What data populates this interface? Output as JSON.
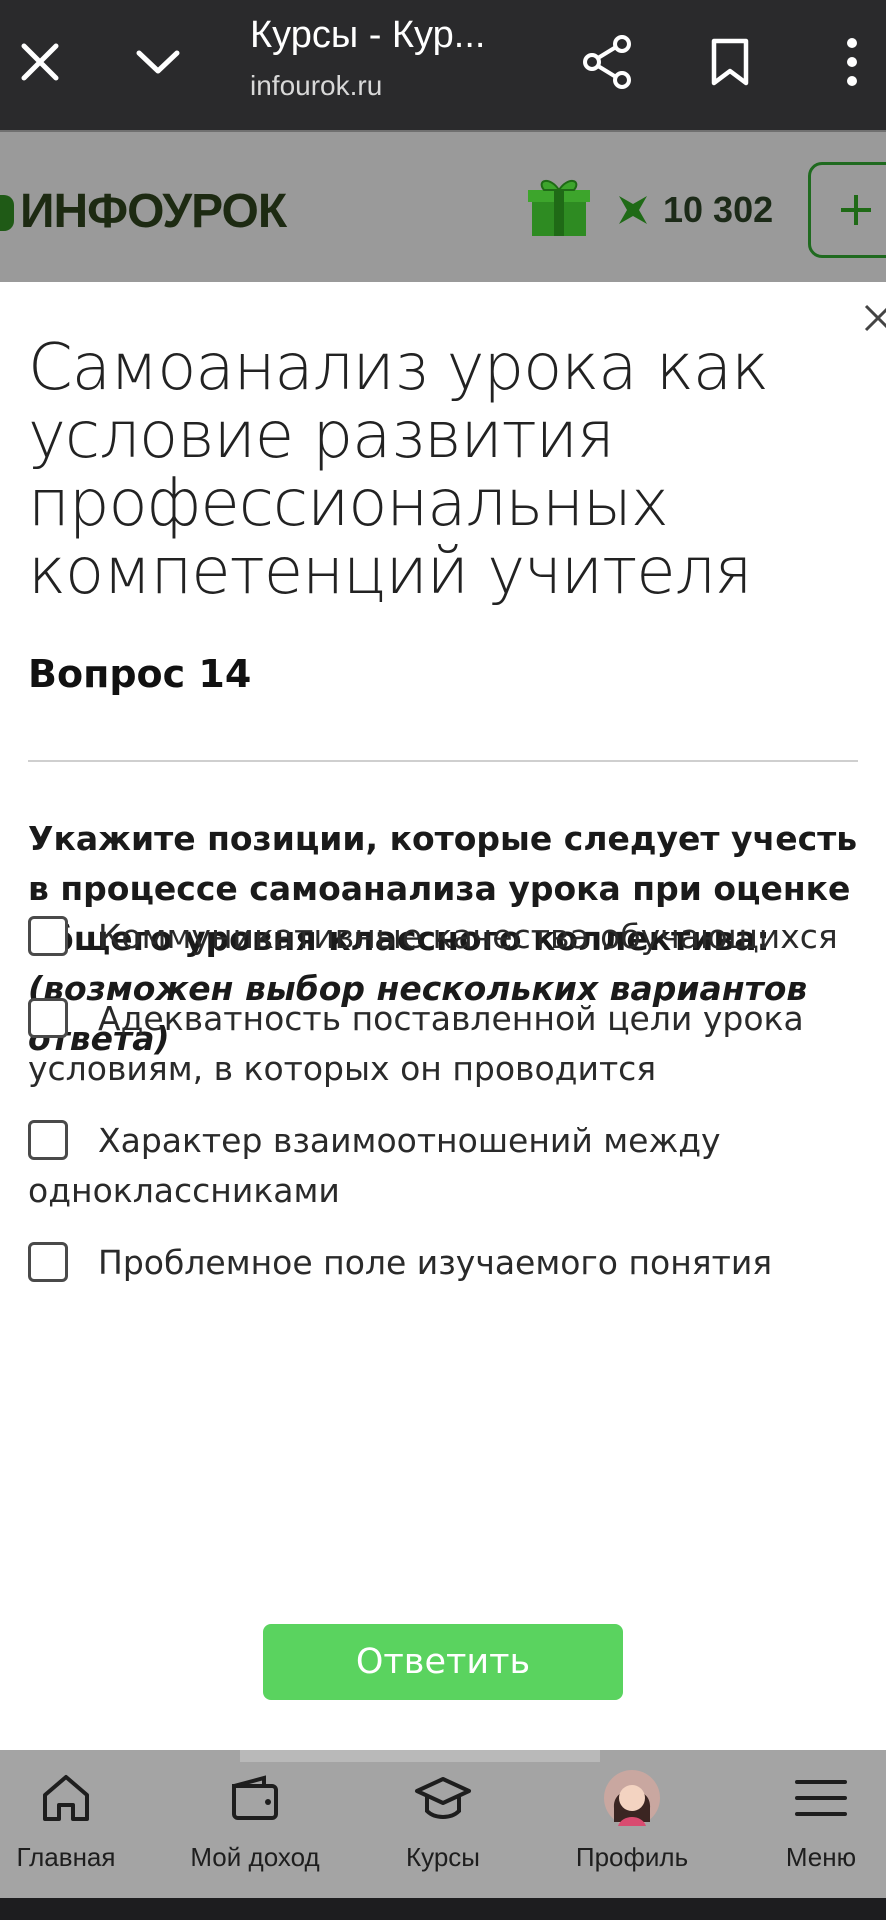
{
  "browser": {
    "title": "Курсы - Кур...",
    "url": "infourok.ru",
    "icons": [
      "close-icon",
      "chevron-down-icon",
      "share-icon",
      "bookmark-icon",
      "more-vertical-icon"
    ]
  },
  "site": {
    "logo": "ИНФОУРОК",
    "points": "10 302",
    "icons": [
      "gift-icon",
      "points-icon",
      "plus-icon"
    ]
  },
  "modal": {
    "course_title": "Самоанализ урока как условие развития профессиональных компетенций учителя",
    "question_number": "Вопрос 14",
    "question_text": "Укажите позиции, которые следует учесть в процессе самоанализа урока при оценке общего уровня классного коллектива:",
    "question_hint": "(возможен выбор нескольких вариантов ответа)",
    "options": [
      "Коммуникативные качества обучающихся",
      "Адекватность поставленной цели урока условиям, в которых он проводится",
      "Характер взаимоотношений между одноклассниками",
      "Проблемное поле изучаемого понятия"
    ],
    "submit_label": "Ответить"
  },
  "bottom_nav": {
    "items": [
      {
        "label": "Главная",
        "icon": "home-icon"
      },
      {
        "label": "Мой доход",
        "icon": "wallet-icon"
      },
      {
        "label": "Курсы",
        "icon": "graduation-cap-icon"
      },
      {
        "label": "Профиль",
        "icon": "avatar"
      },
      {
        "label": "Меню",
        "icon": "menu-icon"
      }
    ]
  },
  "colors": {
    "accent_green": "#5ad35f",
    "browser_bar": "#2a2a2c",
    "dim_overlay": "#9a9a9a"
  }
}
